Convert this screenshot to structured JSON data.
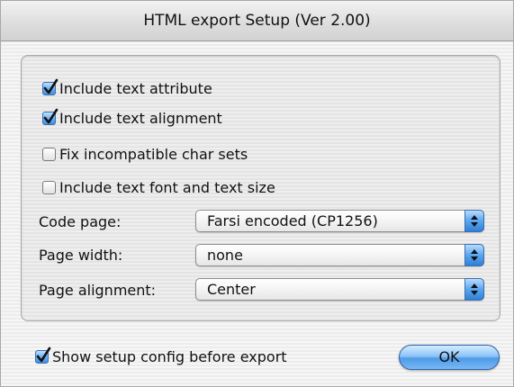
{
  "dialog": {
    "title": "HTML export Setup (Ver 2.00)"
  },
  "options": [
    {
      "label": "Include text attribute",
      "checked": true
    },
    {
      "label": "Include text alignment",
      "checked": true
    },
    {
      "label": "Fix incompatible char sets",
      "checked": false
    },
    {
      "label": "Include text font and text size",
      "checked": false
    }
  ],
  "fields": {
    "code_page": {
      "label": "Code page:",
      "value": "Farsi encoded (CP1256)"
    },
    "page_width": {
      "label": "Page width:",
      "value": "none"
    },
    "page_alignment": {
      "label": "Page alignment:",
      "value": "Center"
    }
  },
  "footer": {
    "show_setup": {
      "label": "Show setup config before export",
      "checked": true
    },
    "ok_label": "OK"
  },
  "colors": {
    "accent_blue": "#5aa6f0",
    "window_bg": "#ececec"
  }
}
